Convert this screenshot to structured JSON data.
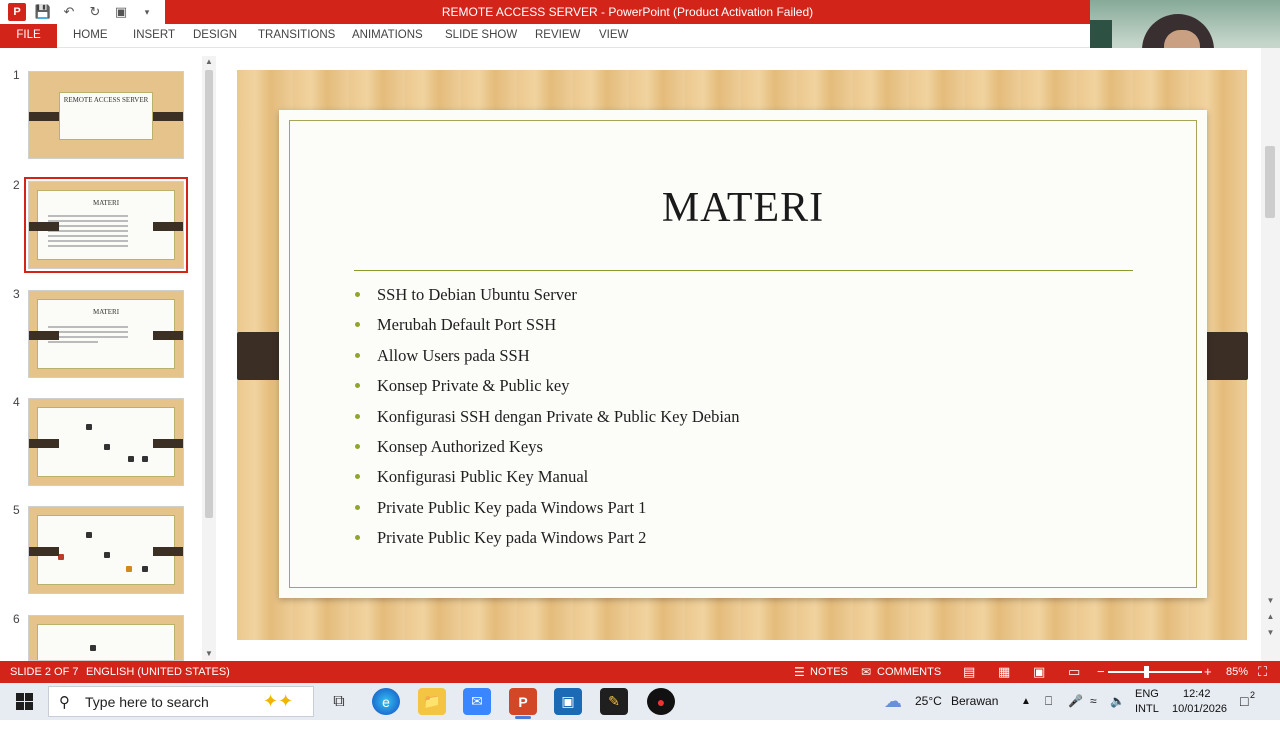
{
  "window": {
    "title": "REMOTE ACCESS SERVER -  PowerPoint (Product Activation Failed)"
  },
  "ribbon": {
    "tabs": [
      "FILE",
      "HOME",
      "INSERT",
      "DESIGN",
      "TRANSITIONS",
      "ANIMATIONS",
      "SLIDE SHOW",
      "REVIEW",
      "VIEW"
    ]
  },
  "thumbnails": {
    "numbers": [
      "1",
      "2",
      "3",
      "4",
      "5",
      "6"
    ],
    "slide1_title": "REMOTE ACCESS SERVER",
    "slide2_title": "MATERI",
    "slide3_title": "MATERI",
    "selected": 2
  },
  "slide": {
    "title": "MATERI",
    "bullets": [
      "SSH to Debian Ubuntu Server",
      "Merubah Default Port SSH",
      "Allow Users pada SSH",
      "Konsep Private & Public key",
      "Konfigurasi SSH dengan Private & Public Key Debian",
      "Konsep Authorized Keys",
      "Konfigurasi Public Key Manual",
      "Private Public Key pada Windows Part 1",
      "Private Public Key pada Windows Part 2"
    ]
  },
  "statusbar": {
    "slide_info": "SLIDE 2 OF 7",
    "language": "ENGLISH (UNITED STATES)",
    "notes": "NOTES",
    "comments": "COMMENTS",
    "zoom_minus": "−",
    "zoom_plus": "+",
    "zoom": "85%"
  },
  "taskbar": {
    "search_placeholder": "Type here to search",
    "weather_temp": "25°C",
    "weather_text": "Berawan",
    "lang_top": "ENG",
    "lang_bottom": "INTL",
    "time": "12:42",
    "date": "10/01/2026",
    "notification_count": "2"
  },
  "colors": {
    "accent": "#d3241a",
    "bullet": "#8fa530",
    "slide_wood": "#ecc88e",
    "slide_band": "#3b2f25"
  }
}
